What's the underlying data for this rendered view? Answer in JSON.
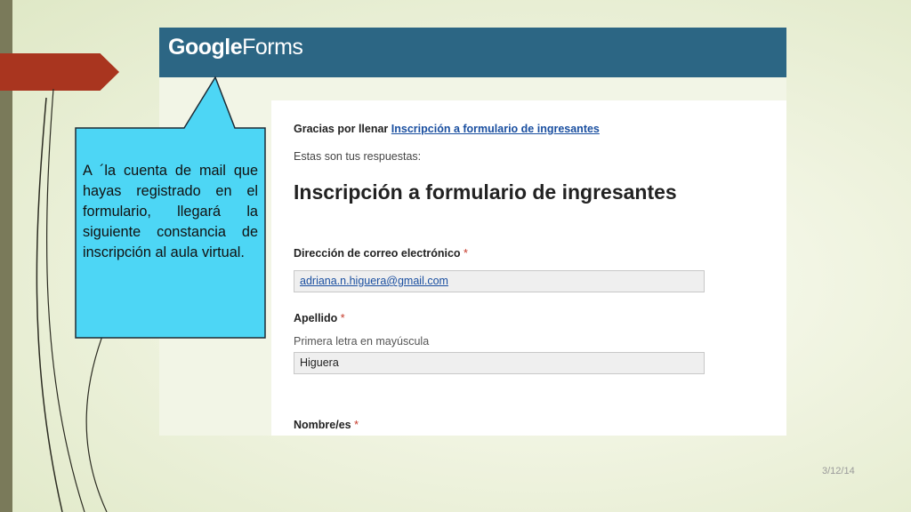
{
  "slide": {
    "callout_text": "A ´la cuenta de mail que hayas registrado en el formulario, llegará la siguiente constancia de inscripción al aula virtual.",
    "date": "3/12/14"
  },
  "google_forms": {
    "logo_google": "Google",
    "logo_forms": "Forms",
    "thanks_prefix": "Gracias por llenar",
    "form_link": "Inscripción a formulario de ingresantes",
    "subtitle": "Estas son tus respuestas:",
    "form_title": "Inscripción a formulario de ingresantes",
    "required_mark": "*",
    "questions": [
      {
        "label": "Dirección de correo electrónico",
        "help": "",
        "answer": "adriana.n.higuera@gmail.com"
      },
      {
        "label": "Apellido",
        "help": "Primera letra en mayúscula",
        "answer": "Higuera"
      },
      {
        "label": "Nombre/es",
        "help": "",
        "answer": ""
      }
    ]
  },
  "colors": {
    "header": "#2c6684",
    "arrow": "#a9351f",
    "callout": "#4dd6f5",
    "link": "#1a4fa0",
    "required": "#c53929"
  }
}
